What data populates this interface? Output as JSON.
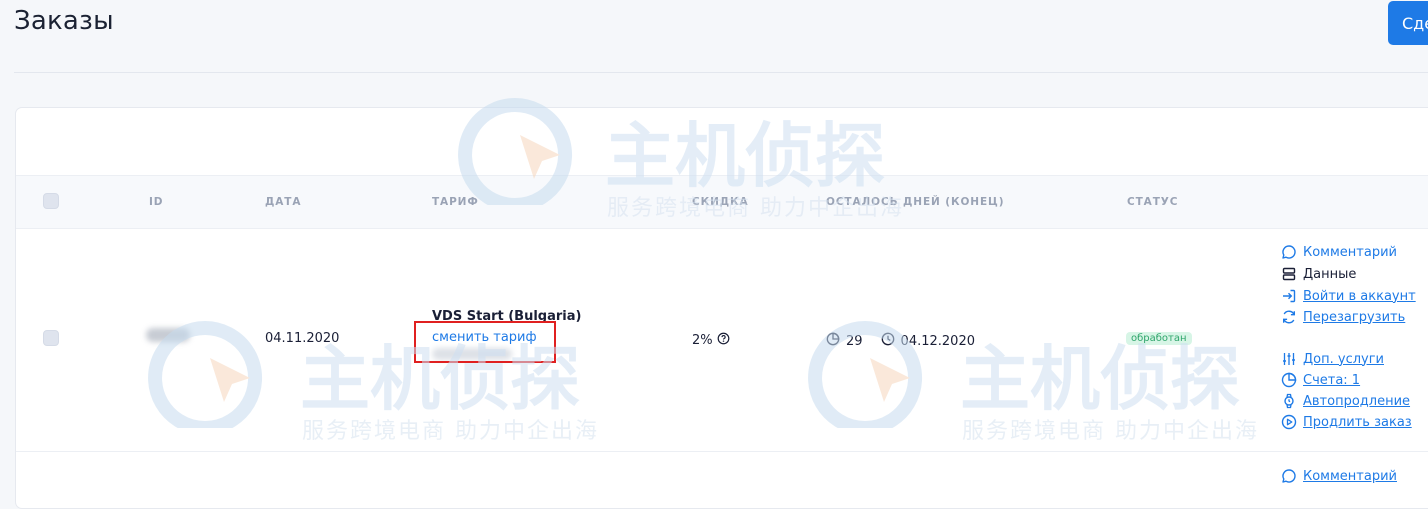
{
  "header": {
    "title": "Заказы",
    "create_button": "Сде"
  },
  "table": {
    "columns": [
      "ID",
      "ДАТА",
      "ТАРИФ",
      "СКИДКА",
      "ОСТАЛОСЬ ДНЕЙ (КОНЕЦ)",
      "СТАТУС"
    ],
    "row": {
      "date": "04.11.2020",
      "tariff": "VDS Start (Bulgaria)",
      "change_tariff": "сменить тариф",
      "discount": "2%",
      "days_left": "29",
      "end_date": "04.12.2020",
      "status": "обработан"
    },
    "actions": [
      {
        "label": "Комментарий",
        "icon": "comment-icon"
      },
      {
        "label": "Данные",
        "icon": "server-icon"
      },
      {
        "label": "Войти в аккаунт",
        "icon": "login-icon"
      },
      {
        "label": "Перезагрузить",
        "icon": "refresh-icon"
      },
      {
        "label": "Доп. услуги",
        "icon": "sliders-icon"
      },
      {
        "label": "Счета: 1",
        "icon": "pie-icon"
      },
      {
        "label": "Автопродление",
        "icon": "watch-icon"
      },
      {
        "label": "Продлить заказ",
        "icon": "play-icon"
      }
    ],
    "next_row_action": "Комментарий"
  },
  "watermark": {
    "brand": "主机侦探",
    "slogan": "服务跨境电商 助力中企出海"
  },
  "colors": {
    "accent": "#1e7ae6",
    "status_bg": "#d7f5e6",
    "status_text": "#2fa56b",
    "highlight": "#e02020"
  }
}
